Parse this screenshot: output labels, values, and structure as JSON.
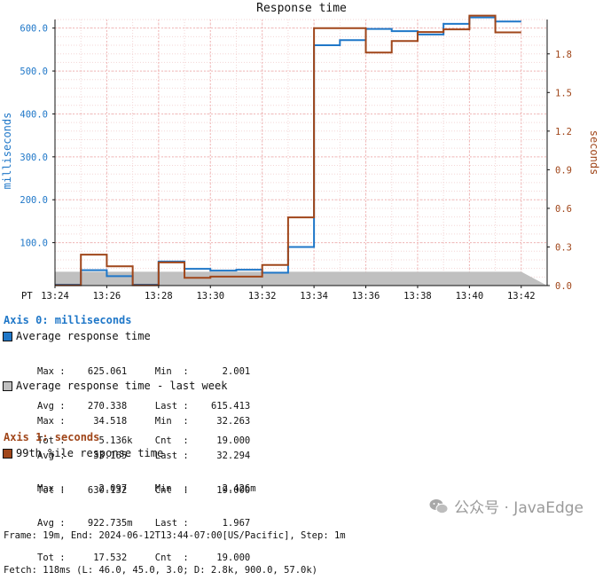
{
  "chart_data": {
    "type": "line",
    "title": "Response time",
    "x_timezone_label": "PT",
    "x_ticks": [
      "13:24",
      "13:26",
      "13:28",
      "13:30",
      "13:32",
      "13:34",
      "13:36",
      "13:38",
      "13:40",
      "13:42"
    ],
    "x_range": [
      "13:24",
      "13:43"
    ],
    "left_axis": {
      "label": "milliseconds",
      "ticks": [
        "100.0",
        "200.0",
        "300.0",
        "400.0",
        "500.0",
        "600.0"
      ],
      "range": [
        0,
        600
      ]
    },
    "right_axis": {
      "label": "seconds",
      "ticks": [
        "0.0",
        "0.3",
        "0.6",
        "0.9",
        "1.2",
        "1.5",
        "1.8"
      ],
      "range": [
        0,
        2.0
      ]
    },
    "series": [
      {
        "name": "Average response time",
        "axis": "left",
        "color": "#1f77c8",
        "style": "step",
        "values": [
          2.0,
          36,
          22,
          2.0,
          56,
          39,
          35,
          37,
          30,
          90,
          560,
          572,
          598,
          593,
          585,
          610,
          625,
          615.4
        ]
      },
      {
        "name": "Average response time - last week",
        "axis": "left",
        "color": "#c0c0c0",
        "style": "area",
        "values": [
          32.3,
          32.3,
          32.3,
          32.3,
          32.3,
          32.3,
          32.3,
          32.3,
          32.3,
          32.3,
          32.3,
          32.3,
          32.3,
          32.3,
          32.3,
          32.3,
          32.3,
          32.3
        ]
      },
      {
        "name": "99th %ile response time",
        "axis": "right",
        "color": "#a0461a",
        "style": "step",
        "values": [
          0.0024,
          0.24,
          0.15,
          0.0024,
          0.18,
          0.06,
          0.07,
          0.07,
          0.16,
          0.53,
          2.0,
          2.0,
          1.81,
          1.9,
          1.97,
          1.99,
          2.097,
          1.967
        ]
      }
    ],
    "grid": true
  },
  "legend": {
    "axis0_title": "Axis 0: milliseconds",
    "axis1_title": "Axis 1: seconds",
    "series": [
      {
        "name": "Average response time",
        "color": "#1f77c8",
        "stats_line1": "Max :    625.061     Min  :      2.001",
        "stats_line2": "Avg :    270.338     Last :    615.413",
        "stats_line3": "Tot :      5.136k    Cnt  :     19.000"
      },
      {
        "name": "Average response time - last week",
        "color": "#c0c0c0",
        "stats_line1": "Max :     34.518     Min  :     32.263",
        "stats_line2": "Avg :     33.165     Last :     32.294",
        "stats_line3": "Tot :    630.132     Cnt  :     19.000"
      },
      {
        "name": "99th %ile response time",
        "color": "#a0461a",
        "stats_line1": "Max :      2.097     Min  :      2.426m",
        "stats_line2": "Avg :    922.735m    Last :      1.967",
        "stats_line3": "Tot :     17.532     Cnt  :     19.000"
      }
    ]
  },
  "footer": {
    "line1": "Frame: 19m, End: 2024-06-12T13:44-07:00[US/Pacific], Step: 1m",
    "line2": "Fetch: 118ms (L: 46.0, 45.0, 3.0; D: 2.8k, 900.0, 57.0k)"
  },
  "watermark": {
    "text": "公众号 · JavaEdge",
    "icon": "wechat-icon"
  },
  "colors": {
    "left_axis": "#1f77c8",
    "right_axis": "#a0461a",
    "grid": "#f0c8c8"
  }
}
